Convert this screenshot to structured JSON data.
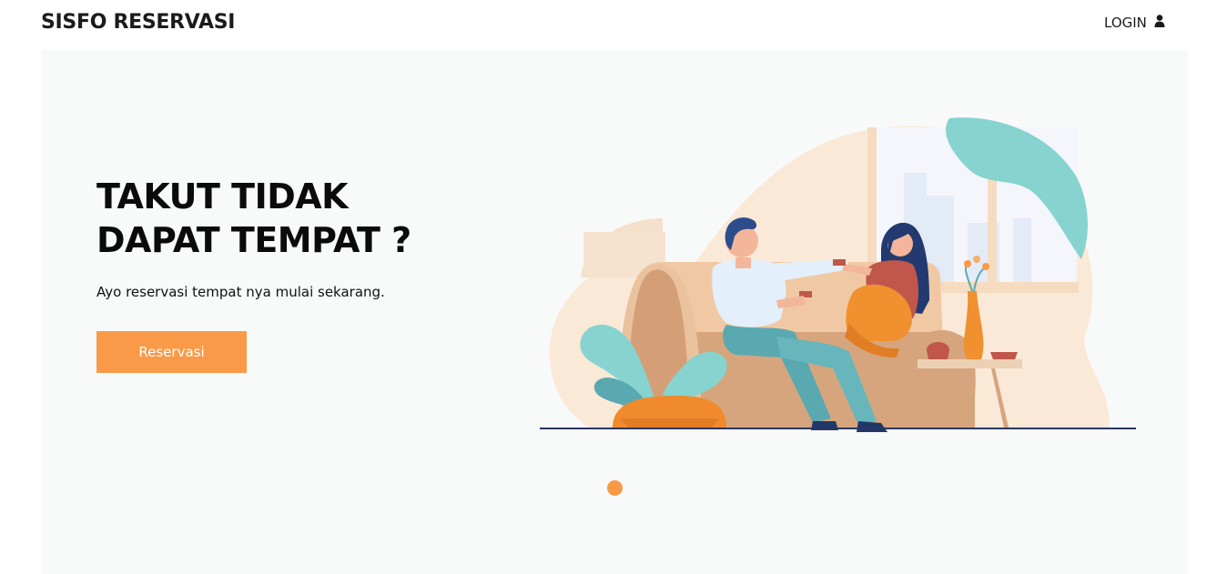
{
  "navbar": {
    "brand": "SISFO RESERVASI",
    "login_label": "LOGIN",
    "login_icon": "user-icon"
  },
  "hero": {
    "title": "TAKUT TIDAK DAPAT TEMPAT ?",
    "subtitle": "Ayo reservasi tempat nya mulai sekarang.",
    "button_label": "Reservasi",
    "illustration": "couple-sofa-illustration"
  },
  "carousel": {
    "active_index": 0,
    "count": 1
  },
  "colors": {
    "accent": "#fa9a48",
    "hero_bg": "#f8f9f9",
    "text": "#0b0b0b"
  }
}
